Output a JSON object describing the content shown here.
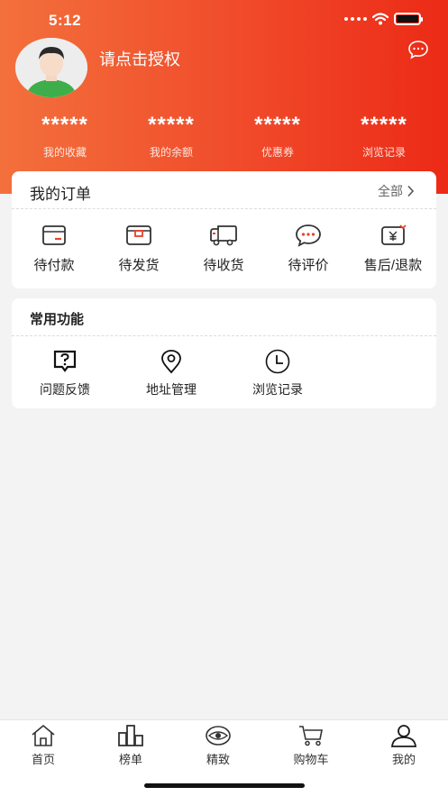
{
  "status_bar": {
    "time": "5:12"
  },
  "profile": {
    "name": "请点击授权",
    "avatar_icon": "user-avatar-icon",
    "message_icon": "chat-bubble-icon"
  },
  "stats": [
    {
      "value": "*****",
      "label": "我的收藏"
    },
    {
      "value": "*****",
      "label": "我的余额"
    },
    {
      "value": "*****",
      "label": "优惠券"
    },
    {
      "value": "*****",
      "label": "浏览记录"
    }
  ],
  "orders": {
    "title": "我的订单",
    "more_label": "全部",
    "items": [
      {
        "label": "待付款",
        "icon": "wallet-icon"
      },
      {
        "label": "待发货",
        "icon": "package-icon"
      },
      {
        "label": "待收货",
        "icon": "truck-icon"
      },
      {
        "label": "待评价",
        "icon": "comment-icon"
      },
      {
        "label": "售后/退款",
        "icon": "refund-icon"
      }
    ]
  },
  "functions": {
    "title": "常用功能",
    "items": [
      {
        "label": "问题反馈",
        "icon": "question-feedback-icon"
      },
      {
        "label": "地址管理",
        "icon": "location-pin-icon"
      },
      {
        "label": "浏览记录",
        "icon": "clock-icon"
      }
    ]
  },
  "tabbar": {
    "items": [
      {
        "label": "首页",
        "icon": "home-icon"
      },
      {
        "label": "榜单",
        "icon": "ranking-icon"
      },
      {
        "label": "精致",
        "icon": "eye-icon"
      },
      {
        "label": "购物车",
        "icon": "cart-icon"
      },
      {
        "label": "我的",
        "icon": "user-icon"
      }
    ],
    "active_index": 4
  },
  "colors": {
    "header_start": "#f3703c",
    "header_end": "#ec2a16",
    "accent": "#e8402a"
  }
}
